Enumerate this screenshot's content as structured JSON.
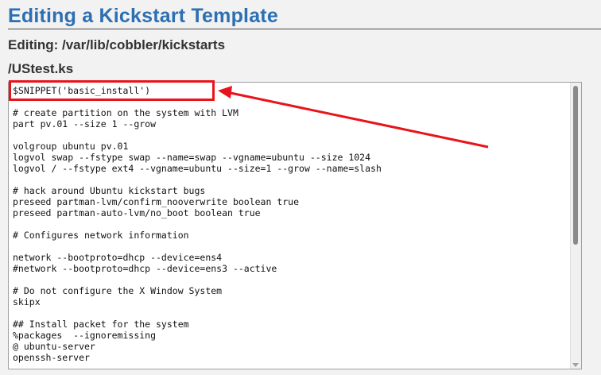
{
  "page": {
    "title": "Editing a Kickstart Template",
    "editing_path": "Editing: /var/lib/cobbler/kickstarts",
    "file_name": "/UStest.ks"
  },
  "editor": {
    "lines": [
      "$SNIPPET('basic_install')",
      "",
      "# create partition on the system with LVM",
      "part pv.01 --size 1 --grow",
      "",
      "volgroup ubuntu pv.01",
      "logvol swap --fstype swap --name=swap --vgname=ubuntu --size 1024",
      "logvol / --fstype ext4 --vgname=ubuntu --size=1 --grow --name=slash",
      "",
      "# hack around Ubuntu kickstart bugs",
      "preseed partman-lvm/confirm_nooverwrite boolean true",
      "preseed partman-auto-lvm/no_boot boolean true",
      "",
      "# Configures network information",
      "",
      "network --bootproto=dhcp --device=ens4",
      "#network --bootproto=dhcp --device=ens3 --active",
      "",
      "# Do not configure the X Window System",
      "skipx",
      "",
      "## Install packet for the system",
      "%packages  --ignoremissing",
      "@ ubuntu-server",
      "openssh-server"
    ]
  },
  "annotation": {
    "color": "#e8141b"
  }
}
